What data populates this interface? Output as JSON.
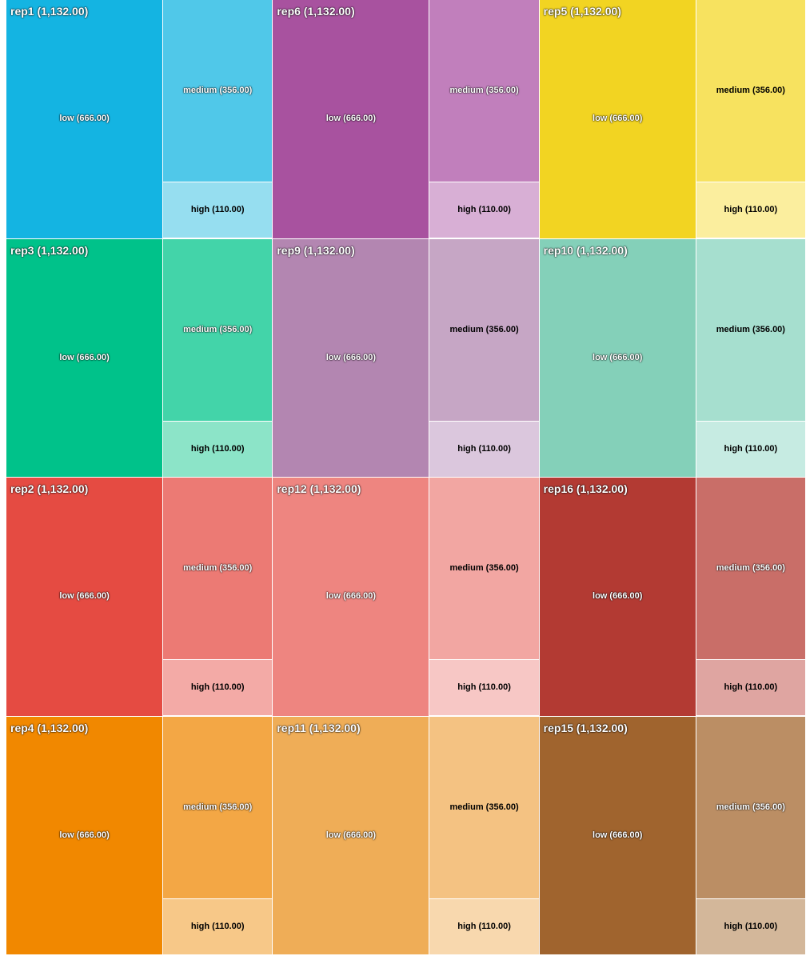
{
  "chart_data": {
    "type": "treemap",
    "groups": [
      {
        "name": "rep1",
        "total_label": "rep1 (1,132.00)",
        "value": 1132,
        "colors": {
          "low": "#14b4e2",
          "medium": "#50c8e9",
          "high": "#96def0"
        },
        "text_styles": {
          "low": "light",
          "medium": "light",
          "high": "dark"
        }
      },
      {
        "name": "rep6",
        "total_label": "rep6 (1,132.00)",
        "value": 1132,
        "colors": {
          "low": "#a8529f",
          "medium": "#c17fbc",
          "high": "#d8afd5"
        },
        "text_styles": {
          "low": "light",
          "medium": "light",
          "high": "dark"
        }
      },
      {
        "name": "rep5",
        "total_label": "rep5 (1,132.00)",
        "value": 1132,
        "colors": {
          "low": "#f2d422",
          "medium": "#f7e25f",
          "high": "#fbee9e"
        },
        "text_styles": {
          "low": "light",
          "medium": "dark",
          "high": "dark"
        }
      },
      {
        "name": "rep3",
        "total_label": "rep3 (1,132.00)",
        "value": 1132,
        "colors": {
          "low": "#00c28a",
          "medium": "#43d4a9",
          "high": "#8ce4c8"
        },
        "text_styles": {
          "low": "light",
          "medium": "light",
          "high": "dark"
        }
      },
      {
        "name": "rep9",
        "total_label": "rep9 (1,132.00)",
        "value": 1132,
        "colors": {
          "low": "#b386b1",
          "medium": "#c6a6c5",
          "high": "#dbc7dd"
        },
        "text_styles": {
          "low": "light",
          "medium": "dark",
          "high": "dark"
        }
      },
      {
        "name": "rep10",
        "total_label": "rep10 (1,132.00)",
        "value": 1132,
        "colors": {
          "low": "#84d0b9",
          "medium": "#a6dfcf",
          "high": "#c6ebe2"
        },
        "text_styles": {
          "low": "light",
          "medium": "dark",
          "high": "dark"
        }
      },
      {
        "name": "rep2",
        "total_label": "rep2 (1,132.00)",
        "value": 1132,
        "colors": {
          "low": "#e54b42",
          "medium": "#ec7a74",
          "high": "#f3aaa6"
        },
        "text_styles": {
          "low": "light",
          "medium": "light",
          "high": "dark"
        }
      },
      {
        "name": "rep12",
        "total_label": "rep12 (1,132.00)",
        "value": 1132,
        "colors": {
          "low": "#ee8580",
          "medium": "#f2a6a2",
          "high": "#f7c7c5"
        },
        "text_styles": {
          "low": "light",
          "medium": "dark",
          "high": "dark"
        }
      },
      {
        "name": "rep16",
        "total_label": "rep16 (1,132.00)",
        "value": 1132,
        "colors": {
          "low": "#b33a33",
          "medium": "#c96e68",
          "high": "#dfa5a1"
        },
        "text_styles": {
          "low": "light",
          "medium": "light",
          "high": "dark"
        }
      },
      {
        "name": "rep4",
        "total_label": "rep4 (1,132.00)",
        "value": 1132,
        "colors": {
          "low": "#f18800",
          "medium": "#f3a745",
          "high": "#f7c888"
        },
        "text_styles": {
          "low": "light",
          "medium": "light",
          "high": "dark"
        }
      },
      {
        "name": "rep11",
        "total_label": "rep11 (1,132.00)",
        "value": 1132,
        "colors": {
          "low": "#efad57",
          "medium": "#f4c282",
          "high": "#f8d8ae"
        },
        "text_styles": {
          "low": "light",
          "medium": "dark",
          "high": "dark"
        }
      },
      {
        "name": "rep15",
        "total_label": "rep15 (1,132.00)",
        "value": 1132,
        "colors": {
          "low": "#a0642e",
          "medium": "#bb8e64",
          "high": "#d3b79a"
        },
        "text_styles": {
          "low": "light",
          "medium": "light",
          "high": "dark"
        }
      }
    ],
    "children": [
      {
        "name": "low",
        "value": 666,
        "label": "low (666.00)"
      },
      {
        "name": "medium",
        "value": 356,
        "label": "medium (356.00)"
      },
      {
        "name": "high",
        "value": 110,
        "label": "high (110.00)"
      }
    ],
    "layout": {
      "columns": 3,
      "rows": 4
    }
  }
}
